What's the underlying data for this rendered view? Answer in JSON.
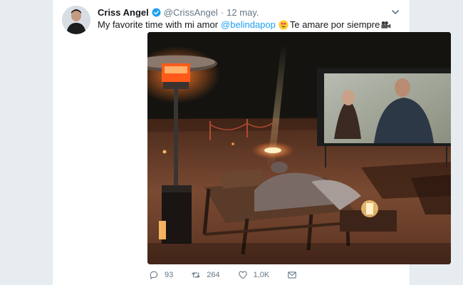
{
  "tweet": {
    "author": {
      "display_name": "Criss Angel",
      "handle": "@CrissAngel",
      "verified": true
    },
    "separator": "·",
    "date": "12 may.",
    "text": {
      "lead": "My favorite time with mi amor",
      "mention": "@belindapop",
      "trail": "Te amare por siempre"
    },
    "emoji": [
      "heart-eyes-emoji",
      "movie-camera-emoji"
    ],
    "actions": {
      "replies": "93",
      "retweets": "264",
      "likes": "1,0K"
    }
  },
  "colors": {
    "background": "#e6ecf0",
    "card": "#ffffff",
    "text": "#14171a",
    "secondary": "#657786",
    "link": "#1da1f2",
    "verified": "#1da1f2"
  }
}
